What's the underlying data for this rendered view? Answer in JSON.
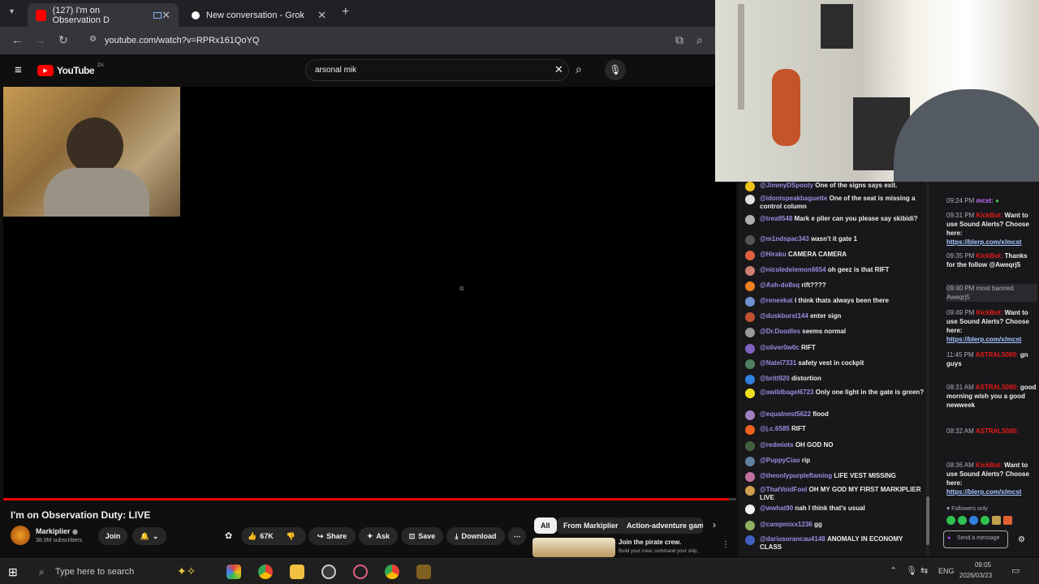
{
  "browser": {
    "tabs": [
      {
        "label": "(127) I'm on Observation D",
        "active": true
      },
      {
        "label": "New conversation - Grok",
        "active": false
      }
    ],
    "url": "youtube.com/watch?v=RPRx161QoYQ"
  },
  "youtube": {
    "logo_text": "YouTube",
    "region": "ZA",
    "search_value": "arsonal mik",
    "video_title": "I'm on Observation Duty: LIVE",
    "channel": "Markiplier",
    "subscribers": "38.9M subscribers",
    "join_label": "Join",
    "likes": "67K",
    "share_label": "Share",
    "ask_label": "Ask",
    "save_label": "Save",
    "download_label": "Download",
    "chips": [
      "All",
      "From Markiplier",
      "Action-adventure games"
    ],
    "rec_title": "Join the pirate crew.",
    "rec_sub": "Build your crew, command your ship,"
  },
  "chat_left": [
    {
      "user": "@JimmyDSpooty",
      "text": "One of the signs says exit.",
      "color": "#f0c419"
    },
    {
      "user": "@idontspeakbaguette",
      "text": "One of the seat is missing a control column",
      "color": "#e0e0e0"
    },
    {
      "user": "@trea9548",
      "text": "Mark e plier can you please say skibidi?",
      "color": "#b0b0b0"
    },
    {
      "user": "@m1ndspac343",
      "text": "wasn't it gate 1",
      "color": "#555"
    },
    {
      "user": "@Hiraku",
      "text": "CAMERA CAMERA",
      "color": "#e06040"
    },
    {
      "user": "@nicoledelemon6654",
      "text": "oh geez is that RIFT",
      "color": "#d08070"
    },
    {
      "user": "@Ash-do8sq",
      "text": "rift????",
      "color": "#f08020"
    },
    {
      "user": "@reneekat",
      "text": "I think thats always been there",
      "color": "#7090d0"
    },
    {
      "user": "@duskburst144",
      "text": "enter sign",
      "color": "#c05030"
    },
    {
      "user": "@Dr.Doodles",
      "text": "seems normal",
      "color": "#999"
    },
    {
      "user": "@oliver0w0c",
      "text": "RIFT",
      "color": "#8060c0"
    },
    {
      "user": "@Natel7331",
      "text": "safety vest in cockpit",
      "color": "#508060"
    },
    {
      "user": "@britt920",
      "text": "distortion",
      "color": "#3080e0"
    },
    {
      "user": "@awildbagel6723",
      "text": "Only one light in the gate is green?",
      "color": "#f0e020"
    },
    {
      "user": "@equalnest5622",
      "text": "flood",
      "color": "#a080c0"
    },
    {
      "user": "@j.c.6585",
      "text": "RIFT",
      "color": "#f06020"
    },
    {
      "user": "@redmiots",
      "text": "OH GOD NO",
      "color": "#406040"
    },
    {
      "user": "@PuppyCiao",
      "text": "rip",
      "color": "#6080a0"
    },
    {
      "user": "@theonlypurpleflaming",
      "text": "LIFE VEST MISSING",
      "color": "#c070a0"
    },
    {
      "user": "@ThatVoidFool",
      "text": "OH MY GOD MY FIRST MARKIPLIER LIVE",
      "color": "#d0a050"
    },
    {
      "user": "@wwhat90",
      "text": "nah I think that's usual",
      "color": "#f0f0f0"
    },
    {
      "user": "@campmixx1236",
      "text": "gg",
      "color": "#90b060"
    },
    {
      "user": "@dariusorancau4148",
      "text": "ANOMALY IN ECONOMY CLASS",
      "color": "#4060c0"
    }
  ],
  "chat_right": {
    "time1": "09:24 PM",
    "user1": "mcst:",
    "time2": "09:31 PM",
    "bot": "KickBot:",
    "bot_msg": "Want to use Sound Alerts? Choose here:",
    "link": "https://blerp.com/x/mcst",
    "time3": "09:35 PM",
    "thanks": "Thanks for the follow @Aweqrj5",
    "time4": "09:40 PM",
    "banned": "most banned Aweqrj5",
    "time5": "09:49 PM",
    "time6": "11:45 PM",
    "astral": "ASTRAL5080:",
    "gn": "gn guys",
    "time7": "08:31 AM",
    "gm": "good morning wish you a good newweek",
    "time8": "08:32 AM",
    "time9": "08:36 AM",
    "followers": "Followers only",
    "send": "Send a message"
  },
  "taskbar": {
    "search_placeholder": "Type here to search",
    "lang": "ENG",
    "time": "09:05",
    "date": "2026/03/23"
  }
}
